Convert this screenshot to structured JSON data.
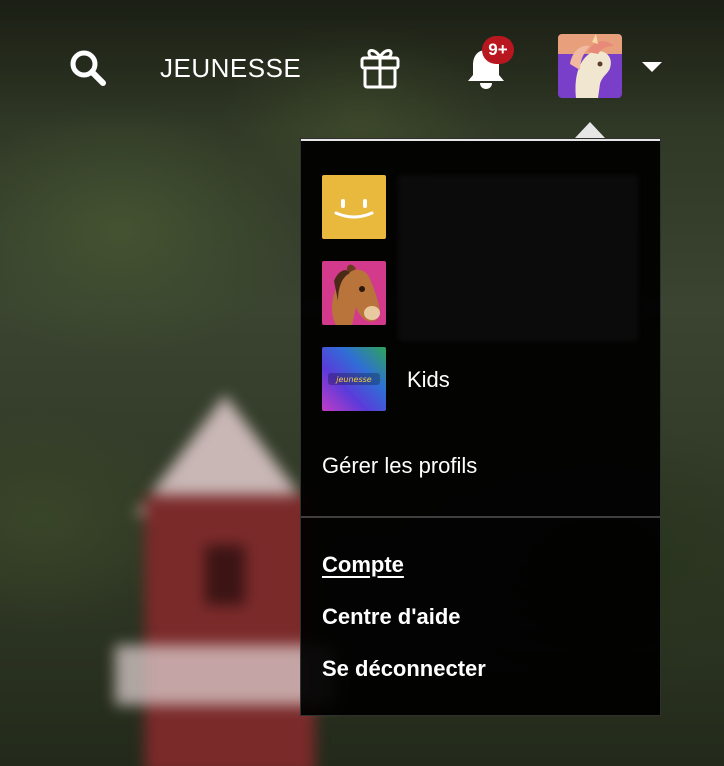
{
  "header": {
    "nav_label": "JEUNESSE",
    "notifications_badge": "9+",
    "icons": {
      "search": "search-icon",
      "gift": "gift-icon",
      "notifications": "bell-icon",
      "dropdown": "caret-down-icon"
    }
  },
  "menu": {
    "profiles": [
      {
        "name": "",
        "avatar": "yellow-smiley-avatar"
      },
      {
        "name": "",
        "avatar": "horse-avatar"
      },
      {
        "name": "Kids",
        "avatar": "kids-jeunesse-avatar"
      }
    ],
    "manage_profiles_label": "Gérer les profils",
    "links": [
      {
        "label": "Compte"
      },
      {
        "label": "Centre d'aide"
      },
      {
        "label": "Se déconnecter"
      }
    ]
  },
  "colors": {
    "badge": "#b9171f",
    "menu_background": "#000000",
    "text": "#ffffff",
    "smiley_avatar": "#e8b93c"
  }
}
